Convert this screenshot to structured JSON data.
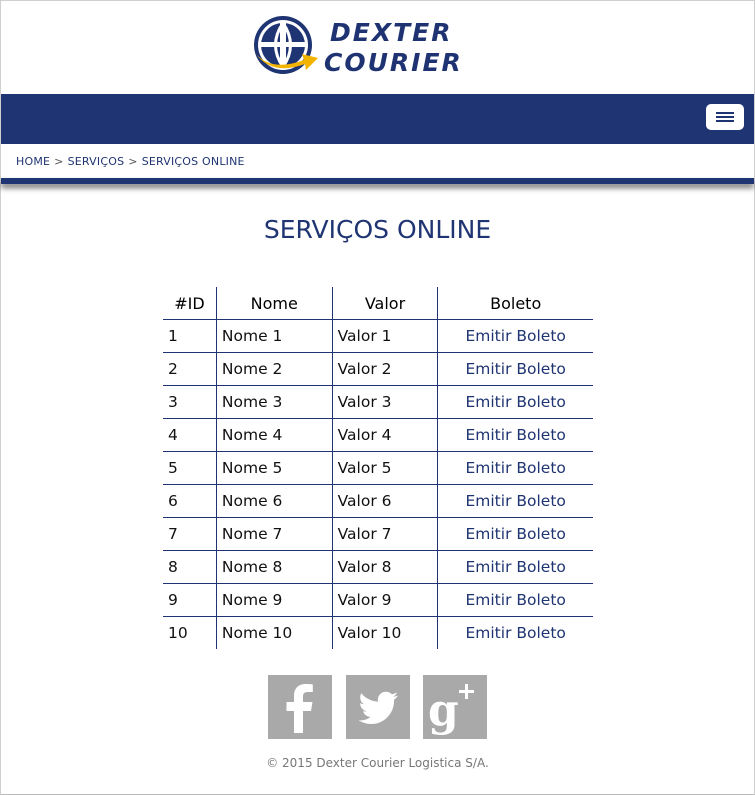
{
  "header": {
    "logo_line1": "DEXTER",
    "logo_line2": "COURIER"
  },
  "colors": {
    "primary": "#1f3472",
    "logo_arrow": "#f2b400",
    "social_bg": "#a9a9a9"
  },
  "nav": {
    "menu_icon": "hamburger-icon"
  },
  "breadcrumb": {
    "home": "HOME",
    "sep": ">",
    "servicos": "SERVIÇOS",
    "current": "SERVIÇOS ONLINE"
  },
  "page_title": "SERVIÇOS ONLINE",
  "table": {
    "headers": [
      "#ID",
      "Nome",
      "Valor",
      "Boleto"
    ],
    "rows": [
      {
        "id": "1",
        "nome": "Nome 1",
        "valor": "Valor 1",
        "boleto": "Emitir Boleto"
      },
      {
        "id": "2",
        "nome": "Nome 2",
        "valor": "Valor 2",
        "boleto": "Emitir Boleto"
      },
      {
        "id": "3",
        "nome": "Nome 3",
        "valor": "Valor 3",
        "boleto": "Emitir Boleto"
      },
      {
        "id": "4",
        "nome": "Nome 4",
        "valor": "Valor 4",
        "boleto": "Emitir Boleto"
      },
      {
        "id": "5",
        "nome": "Nome 5",
        "valor": "Valor 5",
        "boleto": "Emitir Boleto"
      },
      {
        "id": "6",
        "nome": "Nome 6",
        "valor": "Valor 6",
        "boleto": "Emitir Boleto"
      },
      {
        "id": "7",
        "nome": "Nome 7",
        "valor": "Valor 7",
        "boleto": "Emitir Boleto"
      },
      {
        "id": "8",
        "nome": "Nome 8",
        "valor": "Valor 8",
        "boleto": "Emitir Boleto"
      },
      {
        "id": "9",
        "nome": "Nome 9",
        "valor": "Valor 9",
        "boleto": "Emitir Boleto"
      },
      {
        "id": "10",
        "nome": "Nome 10",
        "valor": "Valor 10",
        "boleto": "Emitir Boleto"
      }
    ]
  },
  "social": [
    {
      "name": "facebook-icon"
    },
    {
      "name": "twitter-icon"
    },
    {
      "name": "google-plus-icon"
    }
  ],
  "footer": {
    "copyright": "© 2015 Dexter Courier Logistica S/A."
  }
}
